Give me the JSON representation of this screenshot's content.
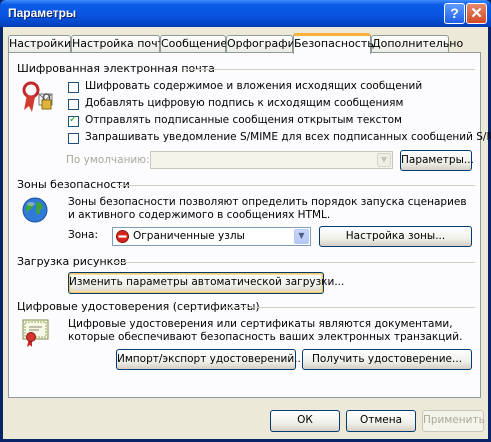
{
  "window": {
    "title": "Параметры",
    "help_label": "?",
    "close_label": "✕"
  },
  "tabs": [
    {
      "label": "Настройки"
    },
    {
      "label": "Настройка почты"
    },
    {
      "label": "Сообщение"
    },
    {
      "label": "Орфография"
    },
    {
      "label": "Безопасность",
      "active": true
    },
    {
      "label": "Дополнительно"
    }
  ],
  "secure_email": {
    "title": "Шифрованная электронная почта",
    "icon": "lock-envelope-icon",
    "options": [
      {
        "label": "Шифровать содержимое и вложения исходящих сообщений",
        "checked": false
      },
      {
        "label": "Добавлять цифровую подпись к исходящим сообщениям",
        "checked": false
      },
      {
        "label": "Отправлять подписанные сообщения открытым текстом",
        "checked": true
      },
      {
        "label": "Запрашивать уведомление S/MIME для всех подписанных сообщений S/MIME",
        "checked": false
      }
    ],
    "default_label": "По умолчанию:",
    "default_value": "",
    "settings_button": "Параметры..."
  },
  "security_zones": {
    "title": "Зоны безопасности",
    "icon": "globe-icon",
    "description": "Зоны безопасности позволяют определить порядок запуска сценариев и активного содержимого в сообщениях HTML.",
    "zone_label": "Зона:",
    "zone_value": "Ограниченные узлы",
    "zone_icon": "restricted-zone-icon",
    "zone_settings_button": "Настройка зоны..."
  },
  "download_pictures": {
    "title": "Загрузка рисунков",
    "button": "Изменить параметры автоматической загрузки..."
  },
  "digital_ids": {
    "title": "Цифровые удостоверения (сертификаты)",
    "icon": "certificate-icon",
    "description": "Цифровые удостоверения или сертификаты являются документами, которые обеспечивают безопасность ваших электронных транзакций.",
    "import_export_button": "Импорт/экспорт удостоверений...",
    "get_id_button": "Получить удостоверение..."
  },
  "footer": {
    "ok": "ОК",
    "cancel": "Отмена",
    "apply": "Применить"
  },
  "colors": {
    "title_bar": "#0a55e0",
    "dialog_bg": "#ece9d8",
    "panel_bg": "#fcfcfe",
    "active_tab_accent": "#f7b13c"
  }
}
